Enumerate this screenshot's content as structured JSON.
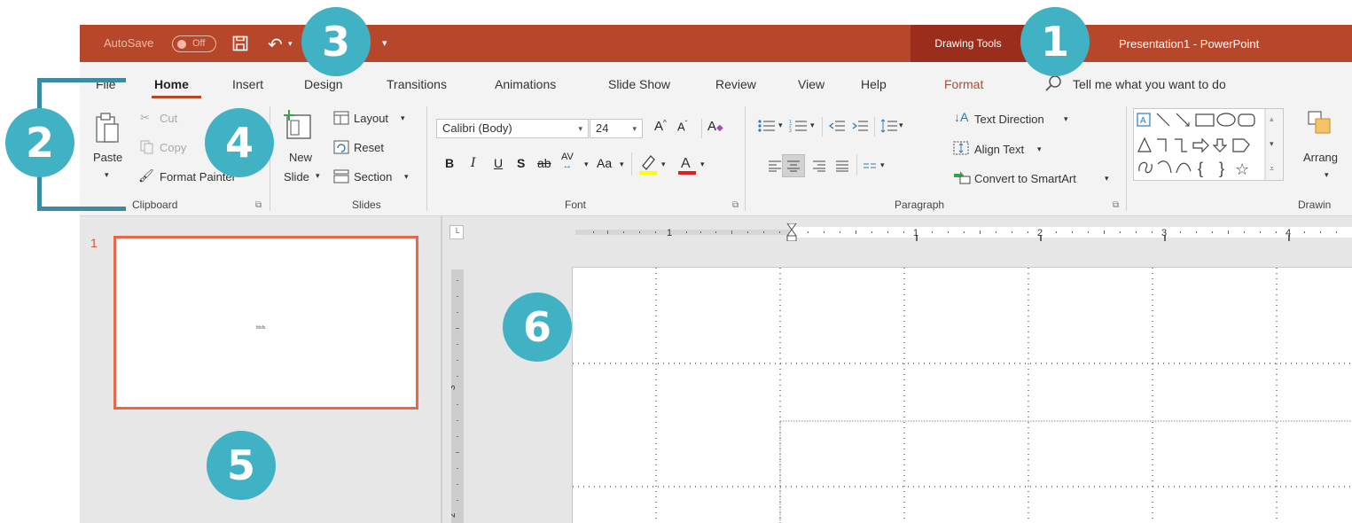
{
  "titlebar": {
    "autosave_label": "AutoSave",
    "autosave_state": "Off",
    "contextual_tab": "Drawing Tools",
    "document_title": "Presentation1  -  PowerPoint"
  },
  "tabs": [
    {
      "label": "File"
    },
    {
      "label": "Home"
    },
    {
      "label": "Insert"
    },
    {
      "label": "Design"
    },
    {
      "label": "Transitions"
    },
    {
      "label": "Animations"
    },
    {
      "label": "Slide Show"
    },
    {
      "label": "Review"
    },
    {
      "label": "View"
    },
    {
      "label": "Help"
    },
    {
      "label": "Format"
    }
  ],
  "search": {
    "label": "Tell me what you want to do"
  },
  "ribbon": {
    "clipboard": {
      "group_label": "Clipboard",
      "paste": "Paste",
      "cut": "Cut",
      "copy": "Copy",
      "format_painter": "Format Painter"
    },
    "slides": {
      "group_label": "Slides",
      "new_slide_line1": "New",
      "new_slide_line2": "Slide",
      "layout": "Layout",
      "reset": "Reset",
      "section": "Section"
    },
    "font": {
      "group_label": "Font",
      "font_name": "Calibri (Body)",
      "font_size": "24",
      "change_case": "Aa"
    },
    "paragraph": {
      "group_label": "Paragraph",
      "text_direction": "Text Direction",
      "align_text": "Align Text",
      "convert_smartart": "Convert to SmartArt"
    },
    "drawing": {
      "group_label": "Drawin",
      "arrange": "Arrang"
    }
  },
  "slide_pane": {
    "slide_number": "1",
    "thumbnail_text": "fdsfs"
  },
  "ruler": {
    "h_labels": [
      "1",
      "1",
      "2",
      "3",
      "4"
    ],
    "v_labels": [
      "3",
      "2"
    ]
  },
  "callouts": [
    "1",
    "2",
    "3",
    "4",
    "5",
    "6"
  ],
  "colors": {
    "titlebar": "#b7472a",
    "contextual": "#9b2d1c",
    "accent": "#b7472a",
    "callout": "#41b1c4",
    "thumbnail_border": "#e8694a"
  }
}
